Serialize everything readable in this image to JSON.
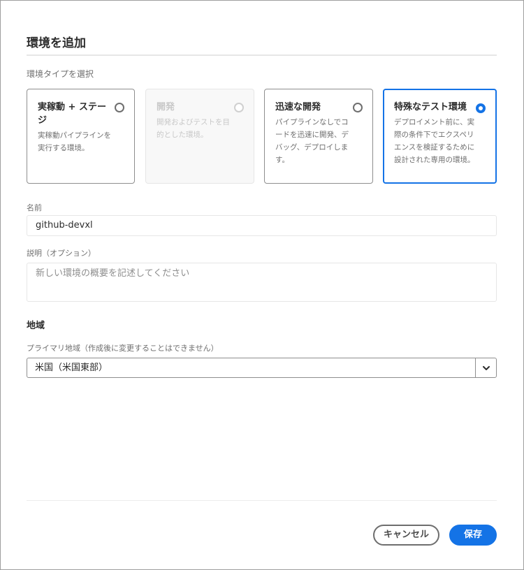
{
  "dialog": {
    "title": "環境を追加"
  },
  "env_type": {
    "label": "環境タイプを選択",
    "options": [
      {
        "title": "実稼動 + ステージ",
        "desc": "実稼動パイプラインを実行する環境。",
        "selected": false,
        "disabled": false
      },
      {
        "title": "開発",
        "desc": "開発およびテストを目的とした環境。",
        "selected": false,
        "disabled": true
      },
      {
        "title": "迅速な開発",
        "desc": "パイプラインなしでコードを迅速に開発、デバッグ、デプロイします。",
        "selected": false,
        "disabled": false
      },
      {
        "title": "特殊なテスト環境",
        "desc": "デプロイメント前に、実際の条件下でエクスペリエンスを検証するために設計された専用の環境。",
        "selected": true,
        "disabled": false
      }
    ]
  },
  "name_field": {
    "label": "名前",
    "value": "github-devxl"
  },
  "description_field": {
    "label": "説明（オプション）",
    "placeholder": "新しい環境の概要を記述してください"
  },
  "region": {
    "heading": "地域",
    "label": "プライマリ地域（作成後に変更することはできません）",
    "selected": "米国（米国東部）"
  },
  "footer": {
    "cancel_label": "キャンセル",
    "save_label": "保存"
  },
  "colors": {
    "accent": "#1473e6",
    "border": "#8e8e8e",
    "muted_text": "#6e6e6e"
  }
}
